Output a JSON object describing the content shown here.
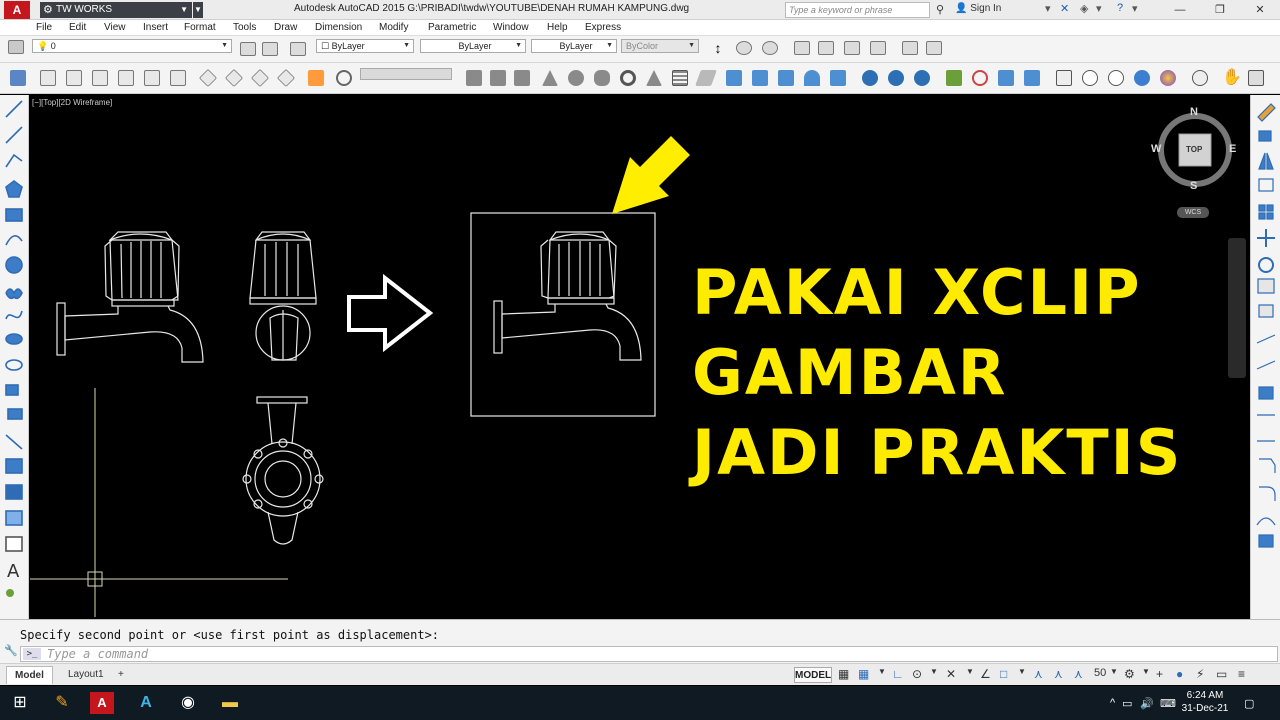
{
  "titlebar": {
    "app_letter": "A",
    "workspace": "TW WORKS",
    "title": "Autodesk AutoCAD 2015    G:\\PRIBADI\\twdw\\YOUTUBE\\DENAH RUMAH KAMPUNG.dwg",
    "search_placeholder": "Type a keyword or phrase",
    "signin": "Sign In"
  },
  "menu": [
    "File",
    "Edit",
    "View",
    "Insert",
    "Format",
    "Tools",
    "Draw",
    "Dimension",
    "Modify",
    "Parametric",
    "Window",
    "Help",
    "Express"
  ],
  "properties_bar": {
    "layer_value": "0",
    "color_value": "ByLayer",
    "linetype_value": "ByLayer",
    "lineweight_value": "ByLayer",
    "plotstyle_value": "ByColor"
  },
  "viewport": {
    "label": "[−][Top][2D Wireframe]",
    "viewcube": {
      "face": "TOP",
      "north": "N",
      "south": "S",
      "east": "E",
      "west": "W",
      "ucs": "WCS"
    }
  },
  "overlay_text": {
    "line1": "PAKAI XCLIP",
    "line2": "GAMBAR",
    "line3": "JADI PRAKTIS"
  },
  "command": {
    "history": "Specify second point or <use first point as displacement>:",
    "input_placeholder": "Type a command"
  },
  "statusbar": {
    "tabs": [
      "Model",
      "Layout1"
    ],
    "model_button": "MODEL",
    "scale": "50"
  },
  "taskbar": {
    "time": "6:24 AM",
    "date": "31-Dec-21"
  },
  "colors": {
    "overlay_yellow": "#ffeb00",
    "arrow_yellow": "#ffee00",
    "autocad_red": "#c4161c"
  }
}
